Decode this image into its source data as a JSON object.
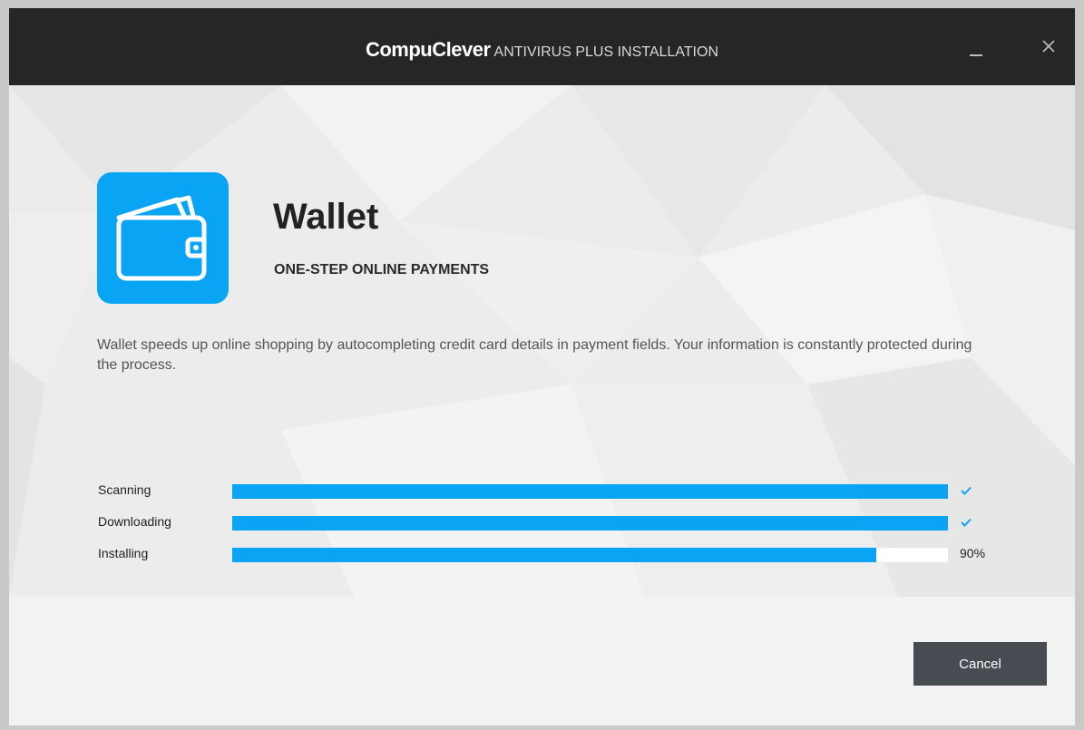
{
  "window": {
    "brand": "CompuClever",
    "title_suffix": "ANTIVIRUS PLUS INSTALLATION"
  },
  "feature": {
    "icon": "wallet-icon",
    "name": "Wallet",
    "tagline": "ONE-STEP ONLINE PAYMENTS",
    "description": "Wallet speeds up online shopping by autocompleting credit card details in payment fields. Your information is constantly protected during the process."
  },
  "progress": [
    {
      "label": "Scanning",
      "fraction": 1.0,
      "status": "",
      "status_icon": "checkmark-icon"
    },
    {
      "label": "Downloading",
      "fraction": 1.0,
      "status": "",
      "status_icon": "checkmark-icon"
    },
    {
      "label": "Installing",
      "fraction": 0.9,
      "status": "90%",
      "status_icon": ""
    }
  ],
  "footer": {
    "cancel_label": "Cancel"
  },
  "colors": {
    "titlebar": "#262626",
    "accent": "#0aa4f5",
    "button": "#474c52"
  }
}
